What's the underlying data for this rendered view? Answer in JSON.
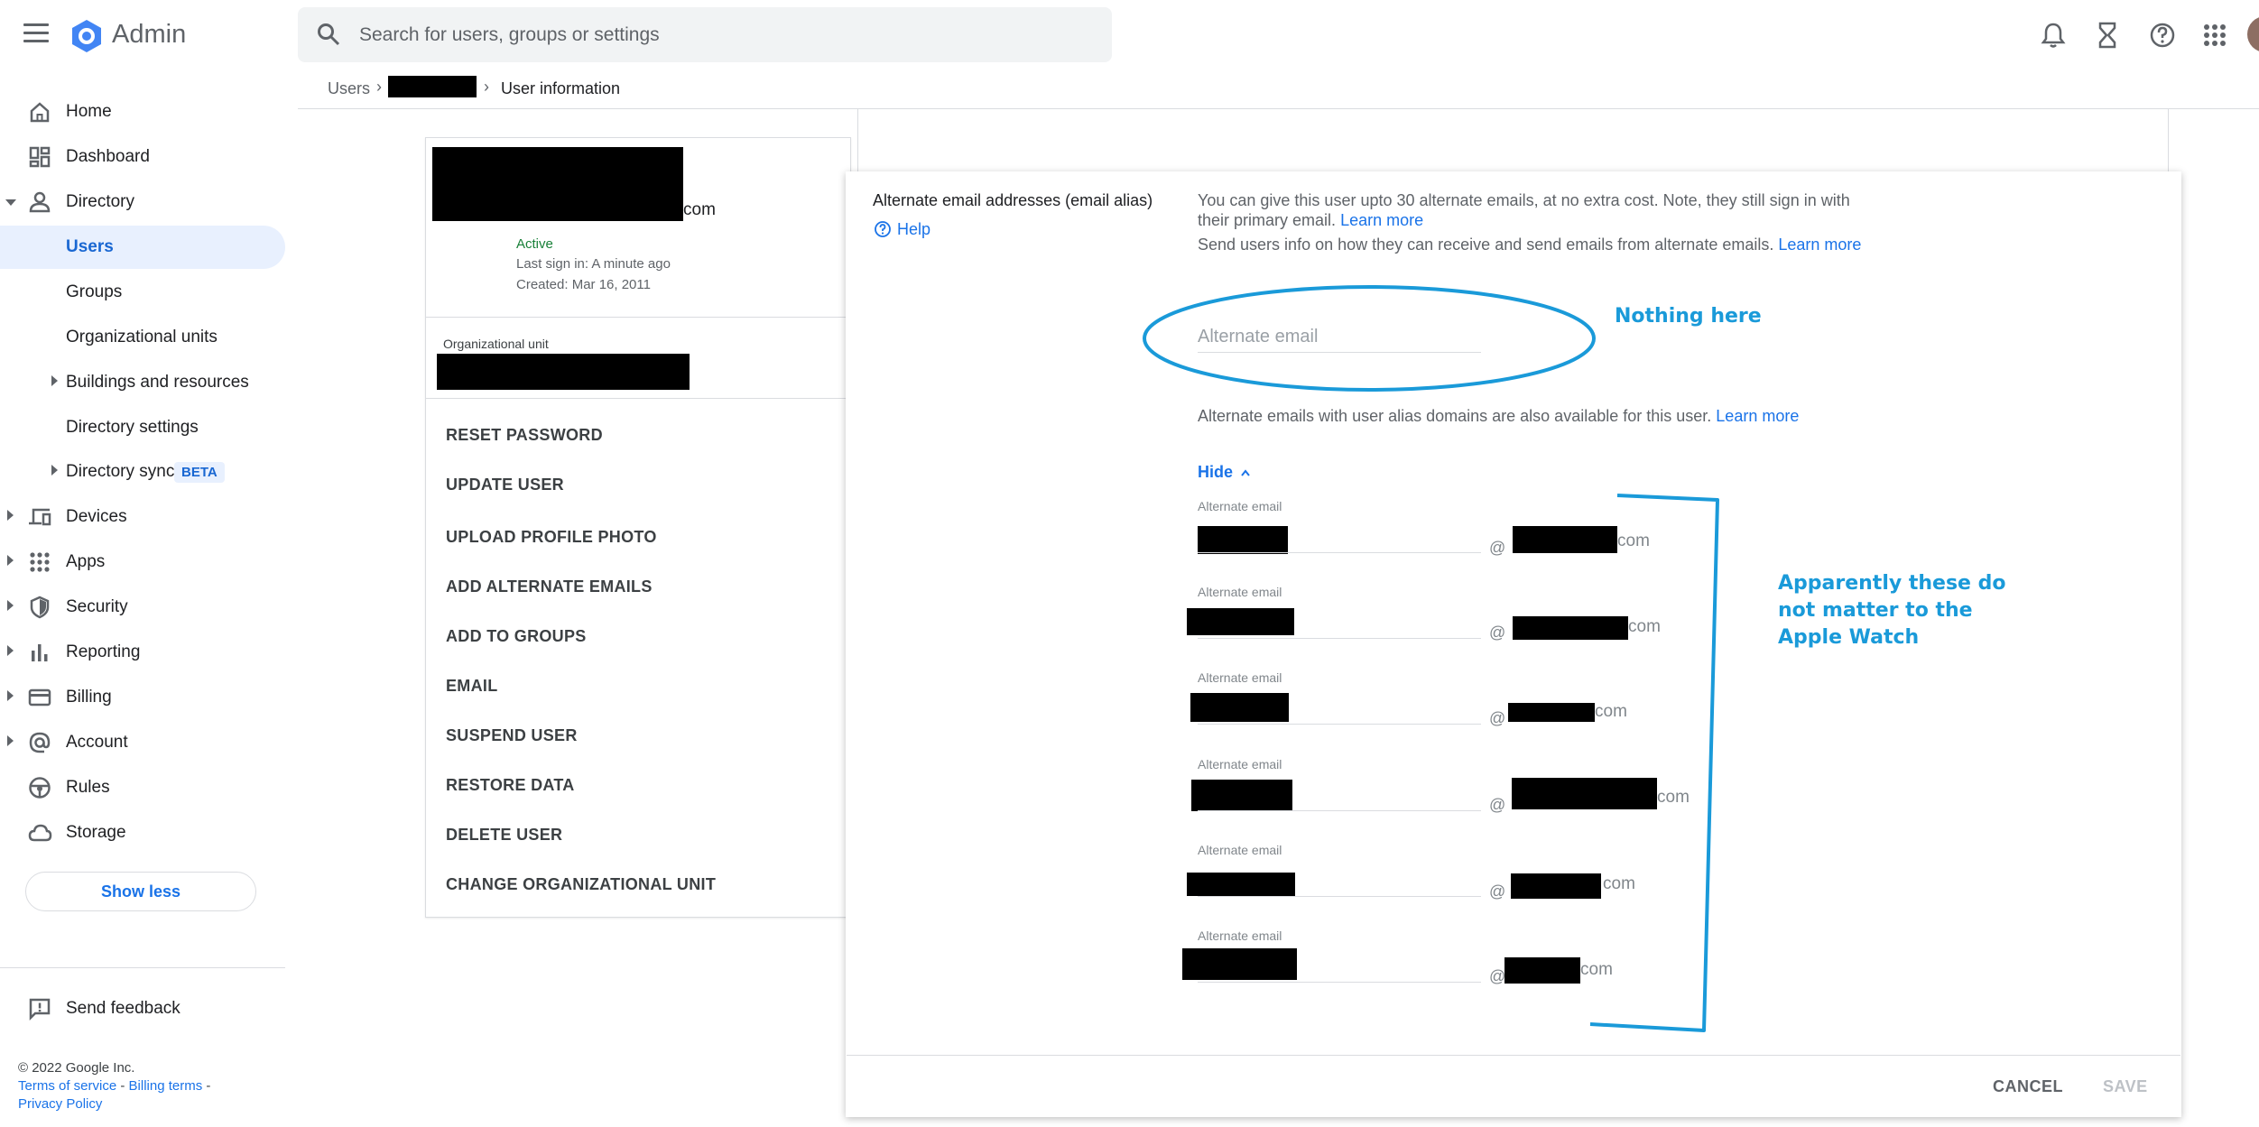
{
  "app": {
    "title": "Admin"
  },
  "search": {
    "placeholder": "Search for users, groups or settings"
  },
  "topbar_icons": [
    "bell-icon",
    "hourglass-icon",
    "help-icon",
    "apps-grid-icon"
  ],
  "sidebar": {
    "items": [
      {
        "label": "Home",
        "icon": "home-icon"
      },
      {
        "label": "Dashboard",
        "icon": "dashboard-icon"
      },
      {
        "label": "Directory",
        "icon": "person-icon",
        "expanded": true
      },
      {
        "label": "Users",
        "selected": true
      },
      {
        "label": "Groups"
      },
      {
        "label": "Organizational units"
      },
      {
        "label": "Buildings and resources"
      },
      {
        "label": "Directory settings"
      },
      {
        "label": "Directory sync",
        "badge": "BETA"
      },
      {
        "label": "Devices",
        "icon": "devices-icon"
      },
      {
        "label": "Apps",
        "icon": "apps-icon"
      },
      {
        "label": "Security",
        "icon": "shield-icon"
      },
      {
        "label": "Reporting",
        "icon": "bar-chart-icon"
      },
      {
        "label": "Billing",
        "icon": "credit-card-icon"
      },
      {
        "label": "Account",
        "icon": "at-sign-icon"
      },
      {
        "label": "Rules",
        "icon": "steering-icon"
      },
      {
        "label": "Storage",
        "icon": "cloud-icon"
      }
    ],
    "show_less": "Show less",
    "send_feedback": "Send feedback",
    "footer": {
      "copyright": "© 2022 Google Inc.",
      "terms": "Terms of service",
      "sep1": " - ",
      "billing_terms": "Billing terms",
      "sep2": " -",
      "privacy": "Privacy Policy"
    }
  },
  "breadcrumb": {
    "users": "Users",
    "current": "User information"
  },
  "user_card": {
    "email_suffix": "com",
    "status": "Active",
    "last_sign_in": "Last sign in: A minute ago",
    "created": "Created: Mar 16, 2011",
    "org_unit_label": "Organizational unit",
    "actions": [
      "RESET PASSWORD",
      "UPDATE USER",
      "UPLOAD PROFILE PHOTO",
      "ADD ALTERNATE EMAILS",
      "ADD TO GROUPS",
      "EMAIL",
      "SUSPEND USER",
      "RESTORE DATA",
      "DELETE USER",
      "CHANGE ORGANIZATIONAL UNIT"
    ]
  },
  "panel": {
    "section_title": "Alternate email addresses (email alias)",
    "help": "Help",
    "desc1": "You can give this user upto 30 alternate emails, at no extra cost. Note, they still sign in with",
    "desc2": "their primary email.",
    "learn_more": "Learn more",
    "desc3": "Send users info on how they can receive and send emails from alternate emails.",
    "new_placeholder": "Alternate email",
    "alias_note": "Alternate emails with user alias domains are also available for this user.",
    "hide": "Hide",
    "field_label": "Alternate email",
    "at": "@",
    "domain_suffix": "com",
    "cancel": "CANCEL",
    "save": "SAVE"
  },
  "annotations": {
    "nothing_here": "Nothing here",
    "apparently_line1": "Apparently these do",
    "apparently_line2": "not matter to the",
    "apparently_line3": "Apple Watch"
  },
  "colors": {
    "accent": "#1a73e8",
    "selected_bg": "#e8f0fe",
    "active_green": "#188038",
    "annotation": "#1a9ad9"
  }
}
